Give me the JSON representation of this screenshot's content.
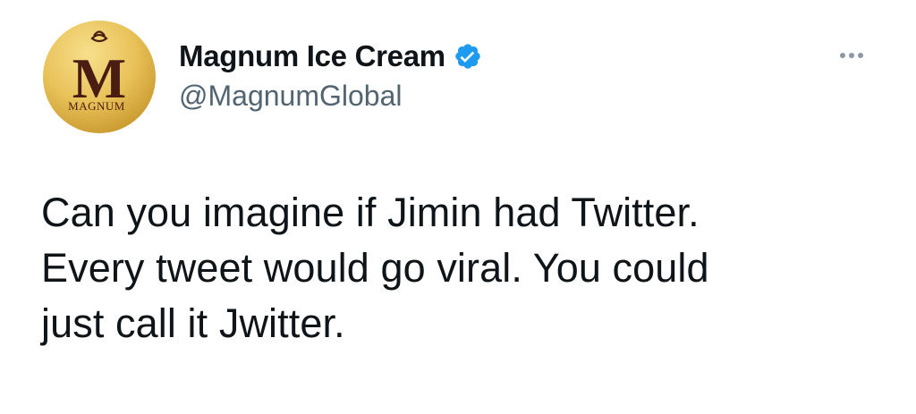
{
  "tweet": {
    "author": {
      "display_name": "Magnum Ice Cream",
      "handle": "@MagnumGlobal",
      "verified": true,
      "avatar": {
        "logo_letter": "M",
        "logo_wordmark": "MAGNUM"
      }
    },
    "more_icon": "more-horizontal-icon",
    "verified_icon": "verified-badge-icon",
    "text_lines": [
      "Can you imagine if Jimin had Twitter.",
      "Every tweet would go viral. You could",
      "just call it Jwitter."
    ]
  },
  "colors": {
    "primary_text": "#0f1419",
    "secondary_text": "#536471",
    "verified_blue": "#1d9bf0",
    "avatar_gold": "#e9c25a",
    "logo_brown": "#4a1d12"
  }
}
